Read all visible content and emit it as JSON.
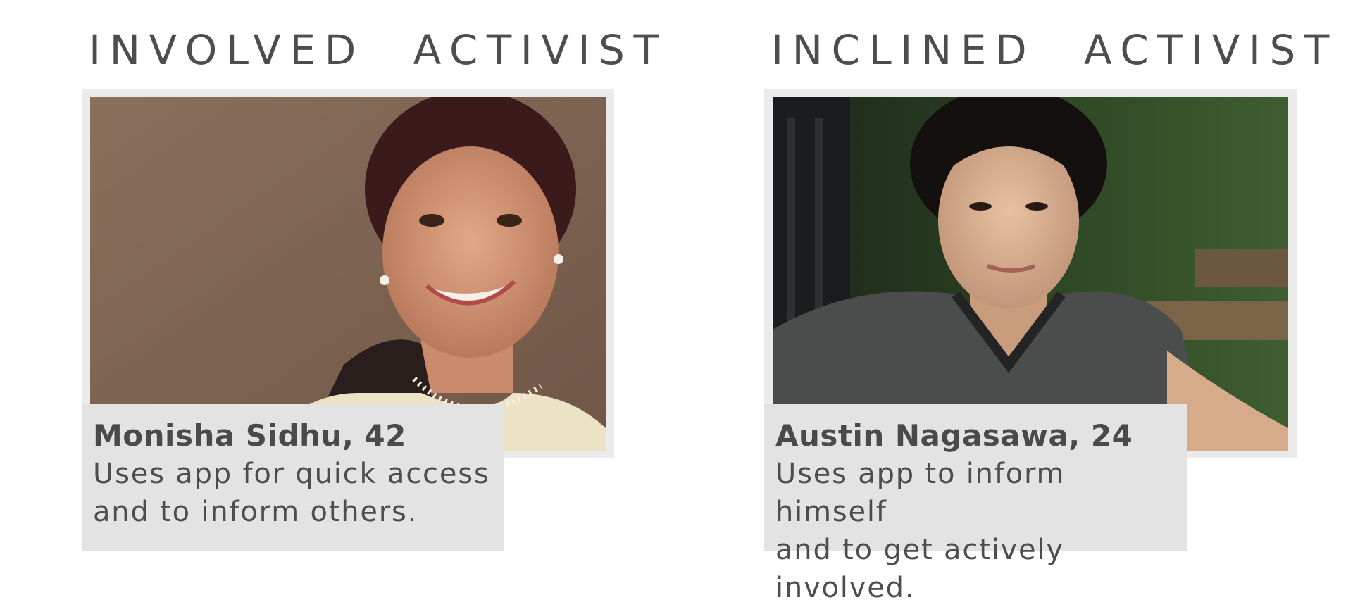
{
  "personas": [
    {
      "heading": "INVOLVED ACTIVIST",
      "name": "Monisha Sidhu, 42",
      "description_line1": "Uses app for quick access",
      "description_line2": "and to inform others."
    },
    {
      "heading": "INCLINED ACTIVIST",
      "name": "Austin Nagasawa, 24",
      "description_line1": "Uses app to inform himself",
      "description_line2": "and to get actively involved."
    }
  ],
  "colors": {
    "text": "#4a4a4a",
    "frame": "#ebebeb",
    "caption_bg": "#e3e3e3"
  }
}
